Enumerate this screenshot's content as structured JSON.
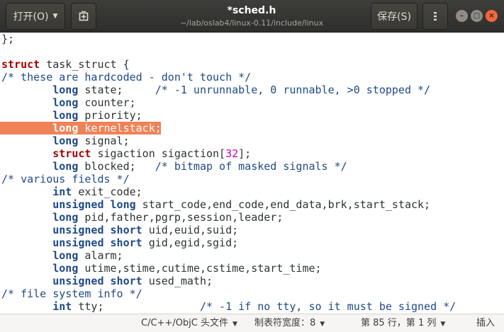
{
  "header": {
    "open_label": "打开(O)",
    "title": "*sched.h",
    "path": "~/lab/oslab4/linux-0.11/include/linux",
    "save_label": "保存(S)",
    "menu_icon": "hamburger-menu-icon",
    "new_doc_icon": "new-document-icon"
  },
  "editor": {
    "highlight_color": "#f08257",
    "lines": [
      [
        {
          "t": "plain",
          "v": "};"
        }
      ],
      [],
      [
        {
          "t": "kw",
          "v": "struct"
        },
        {
          "t": "plain",
          "v": " task_struct {"
        }
      ],
      [
        {
          "t": "comment",
          "v": "/* these are hardcoded - don't touch */"
        }
      ],
      [
        {
          "t": "plain",
          "v": "        "
        },
        {
          "t": "type",
          "v": "long"
        },
        {
          "t": "plain",
          "v": " state;     "
        },
        {
          "t": "comment",
          "v": "/* -1 unrunnable, 0 runnable, >0 stopped */"
        }
      ],
      [
        {
          "t": "plain",
          "v": "        "
        },
        {
          "t": "type",
          "v": "long"
        },
        {
          "t": "plain",
          "v": " counter;"
        }
      ],
      [
        {
          "t": "plain",
          "v": "        "
        },
        {
          "t": "type",
          "v": "long"
        },
        {
          "t": "plain",
          "v": " priority;"
        }
      ],
      [
        {
          "t": "plain",
          "v": "        "
        },
        {
          "t": "type",
          "v": "long"
        },
        {
          "t": "plain",
          "v": " kernelstack;"
        }
      ],
      [
        {
          "t": "plain",
          "v": "        "
        },
        {
          "t": "type",
          "v": "long"
        },
        {
          "t": "plain",
          "v": " signal;"
        }
      ],
      [
        {
          "t": "plain",
          "v": "        "
        },
        {
          "t": "kw",
          "v": "struct"
        },
        {
          "t": "plain",
          "v": " sigaction sigaction["
        },
        {
          "t": "num",
          "v": "32"
        },
        {
          "t": "plain",
          "v": "];"
        }
      ],
      [
        {
          "t": "plain",
          "v": "        "
        },
        {
          "t": "type",
          "v": "long"
        },
        {
          "t": "plain",
          "v": " blocked;   "
        },
        {
          "t": "comment",
          "v": "/* bitmap of masked signals */"
        }
      ],
      [
        {
          "t": "comment",
          "v": "/* various fields */"
        }
      ],
      [
        {
          "t": "plain",
          "v": "        "
        },
        {
          "t": "type",
          "v": "int"
        },
        {
          "t": "plain",
          "v": " exit_code;"
        }
      ],
      [
        {
          "t": "plain",
          "v": "        "
        },
        {
          "t": "type",
          "v": "unsigned long"
        },
        {
          "t": "plain",
          "v": " start_code,end_code,end_data,brk,start_stack;"
        }
      ],
      [
        {
          "t": "plain",
          "v": "        "
        },
        {
          "t": "type",
          "v": "long"
        },
        {
          "t": "plain",
          "v": " pid,father,pgrp,session,leader;"
        }
      ],
      [
        {
          "t": "plain",
          "v": "        "
        },
        {
          "t": "type",
          "v": "unsigned short"
        },
        {
          "t": "plain",
          "v": " uid,euid,suid;"
        }
      ],
      [
        {
          "t": "plain",
          "v": "        "
        },
        {
          "t": "type",
          "v": "unsigned short"
        },
        {
          "t": "plain",
          "v": " gid,egid,sgid;"
        }
      ],
      [
        {
          "t": "plain",
          "v": "        "
        },
        {
          "t": "type",
          "v": "long"
        },
        {
          "t": "plain",
          "v": " alarm;"
        }
      ],
      [
        {
          "t": "plain",
          "v": "        "
        },
        {
          "t": "type",
          "v": "long"
        },
        {
          "t": "plain",
          "v": " utime,stime,cutime,cstime,start_time;"
        }
      ],
      [
        {
          "t": "plain",
          "v": "        "
        },
        {
          "t": "type",
          "v": "unsigned short"
        },
        {
          "t": "plain",
          "v": " used_math;"
        }
      ],
      [
        {
          "t": "comment",
          "v": "/* file system info */"
        }
      ],
      [
        {
          "t": "plain",
          "v": "        "
        },
        {
          "t": "type",
          "v": "int"
        },
        {
          "t": "plain",
          "v": " tty;               "
        },
        {
          "t": "comment",
          "v": "/* -1 if no tty, so it must be signed */"
        }
      ]
    ],
    "highlighted_line": 7
  },
  "statusbar": {
    "language": "C/C++/ObjC 头文件",
    "tab_width": "制表符宽度：8",
    "position": "第 85 行，第 1 列",
    "insert_mode": "插入"
  }
}
